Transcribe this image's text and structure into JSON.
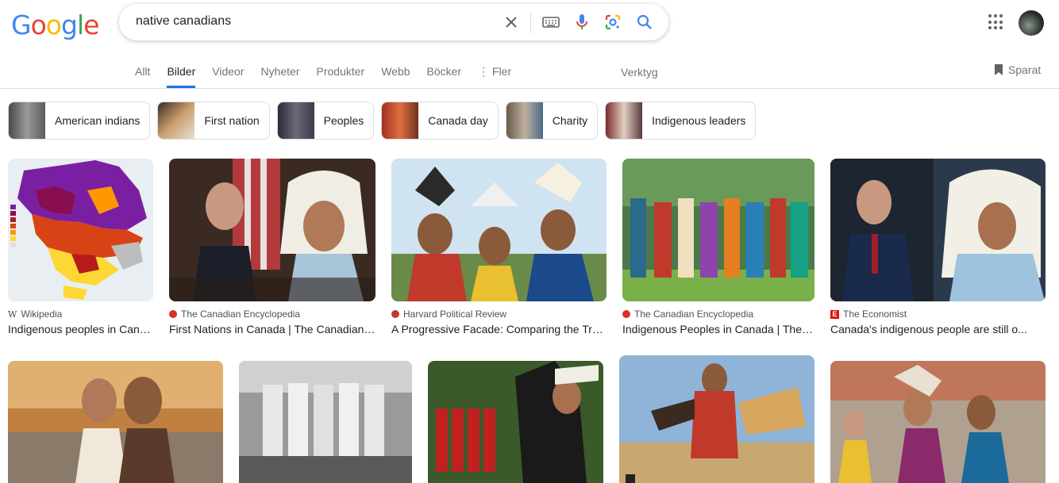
{
  "logo": {
    "letters": [
      "G",
      "o",
      "o",
      "g",
      "l",
      "e"
    ],
    "colors": [
      "#4285f4",
      "#ea4335",
      "#fbbc05",
      "#4285f4",
      "#34a853",
      "#ea4335"
    ]
  },
  "search": {
    "query": "native canadians"
  },
  "tabs": [
    {
      "label": "Allt"
    },
    {
      "label": "Bilder"
    },
    {
      "label": "Videor"
    },
    {
      "label": "Nyheter"
    },
    {
      "label": "Produkter"
    },
    {
      "label": "Webb"
    },
    {
      "label": "Böcker"
    },
    {
      "label": "Fler"
    }
  ],
  "tools_label": "Verktyg",
  "saved_label": "Sparat",
  "chips": [
    {
      "label": "American indians",
      "swatch": "#6b6b6b"
    },
    {
      "label": "First nation",
      "swatch": "#7a5c3a"
    },
    {
      "label": "Peoples",
      "swatch": "#3a3a4a"
    },
    {
      "label": "Canada day",
      "swatch": "#b0502a"
    },
    {
      "label": "Charity",
      "swatch": "#8a7a6a"
    },
    {
      "label": "Indigenous leaders",
      "swatch": "#8a3a3a"
    }
  ],
  "results_row1": [
    {
      "source": "Wikipedia",
      "title": "Indigenous peoples in Canada",
      "fav_color": "#444444",
      "fav_letter": "W"
    },
    {
      "source": "The Canadian Encyclopedia",
      "title": "First Nations in Canada | The Canadian Encyclopedia",
      "fav_color": "#d93025",
      "fav_letter": ""
    },
    {
      "source": "Harvard Political Review",
      "title": "A Progressive Facade: Comparing the Treatment",
      "fav_color": "#c0392b",
      "fav_letter": ""
    },
    {
      "source": "The Canadian Encyclopedia",
      "title": "Indigenous Peoples in Canada | The Canadian",
      "fav_color": "#d93025",
      "fav_letter": ""
    },
    {
      "source": "The Economist",
      "title": "Canada's indigenous people are still o...",
      "fav_color": "#e3120b",
      "fav_letter": "E"
    }
  ]
}
